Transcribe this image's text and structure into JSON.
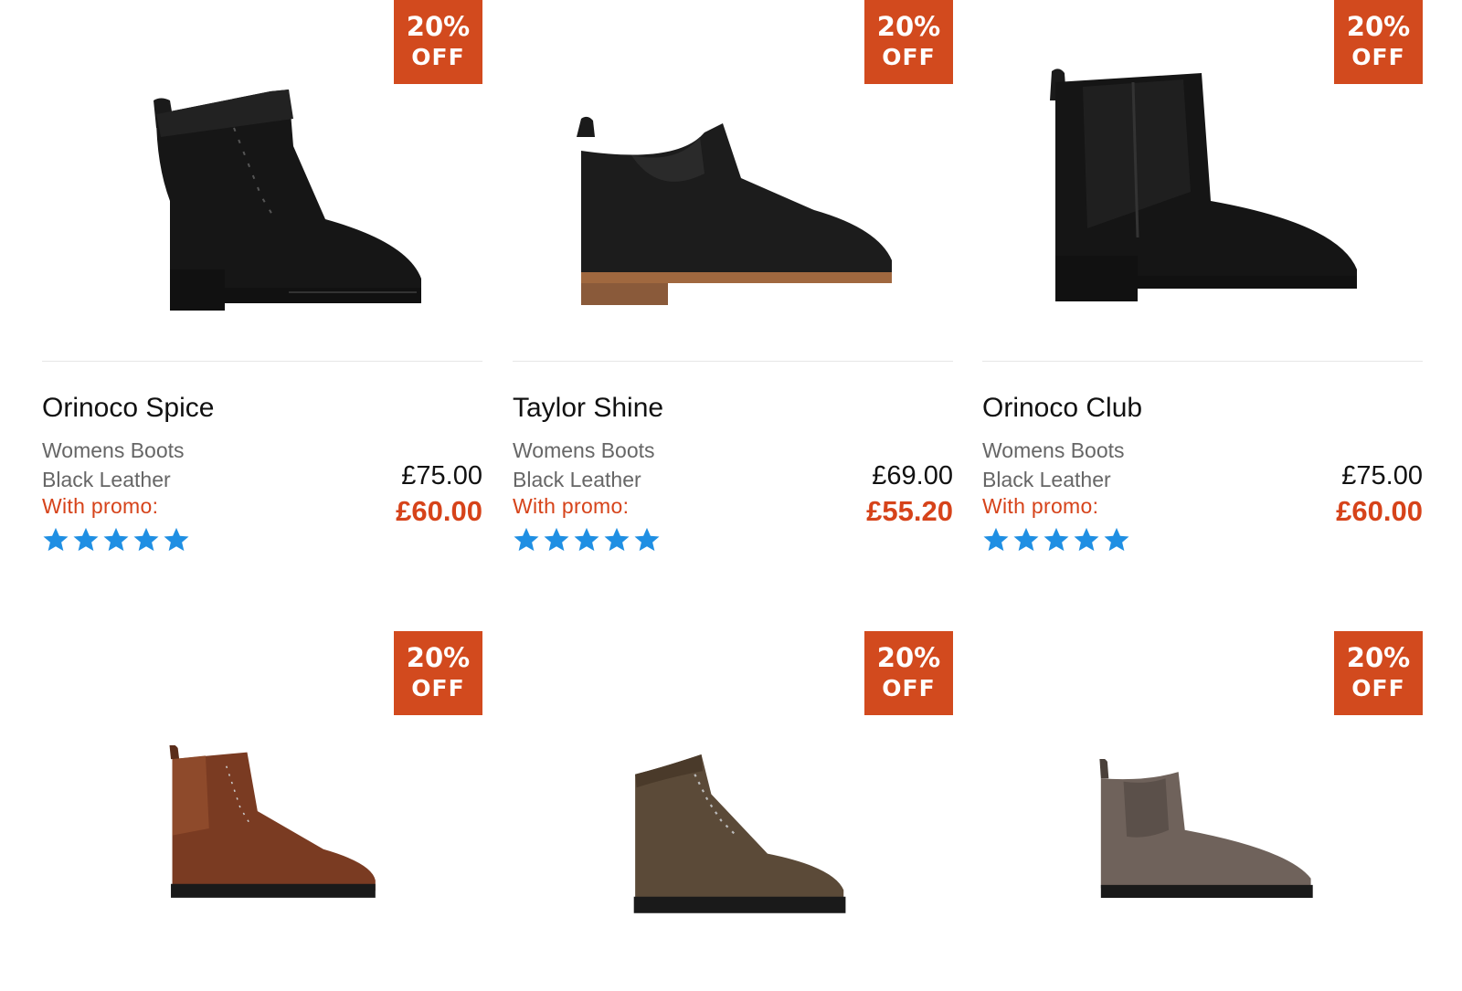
{
  "colors": {
    "badge": "#d24a1e",
    "promo": "#d6431a",
    "star": "#1f8fe3"
  },
  "products": [
    {
      "badge": [
        "20%",
        "OFF"
      ],
      "name": "Orinoco Spice",
      "category": "Womens Boots",
      "color": "Black Leather",
      "promo_label": "With promo:",
      "price": "£75.00",
      "promo_price": "£60.00",
      "rating": 5,
      "image": "black-lace-up-boot"
    },
    {
      "badge": [
        "20%",
        "OFF"
      ],
      "name": "Taylor Shine",
      "category": "Womens Boots",
      "color": "Black Leather",
      "promo_label": "With promo:",
      "price": "£69.00",
      "promo_price": "£55.20",
      "rating": 5,
      "image": "black-chelsea-ankle-boot"
    },
    {
      "badge": [
        "20%",
        "OFF"
      ],
      "name": "Orinoco Club",
      "category": "Womens Boots",
      "color": "Black Leather",
      "promo_label": "With promo:",
      "price": "£75.00",
      "promo_price": "£60.00",
      "rating": 5,
      "image": "black-chelsea-boot"
    },
    {
      "badge": [
        "20%",
        "OFF"
      ],
      "image": "brown-brogue-boot"
    },
    {
      "badge": [
        "20%",
        "OFF"
      ],
      "image": "olive-hiking-boot"
    },
    {
      "badge": [
        "20%",
        "OFF"
      ],
      "image": "taupe-suede-chelsea-boot"
    }
  ]
}
